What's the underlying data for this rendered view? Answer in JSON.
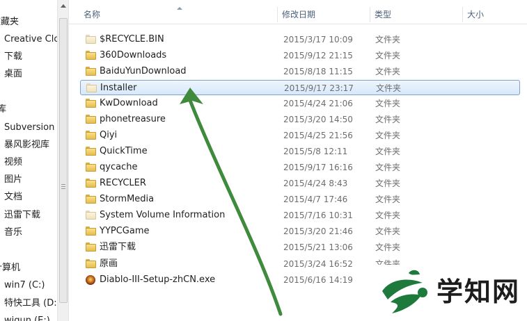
{
  "nav": {
    "items": [
      {
        "label": "收藏夹"
      },
      {
        "label": "Creative Cloud"
      },
      {
        "label": "下载"
      },
      {
        "label": "桌面"
      },
      {
        "label": "库"
      },
      {
        "label": "Subversion"
      },
      {
        "label": "暴风影视库"
      },
      {
        "label": "视频"
      },
      {
        "label": "图片"
      },
      {
        "label": "文档"
      },
      {
        "label": "迅雷下载"
      },
      {
        "label": "音乐"
      },
      {
        "label": "计算机"
      },
      {
        "label": "win7 (C:)"
      },
      {
        "label": "特快工具 (D:)"
      },
      {
        "label": "wiqun (E:)"
      }
    ]
  },
  "columns": {
    "name": "名称",
    "date": "修改日期",
    "type": "类型",
    "size": "大小"
  },
  "files": [
    {
      "name": "$RECYCLE.BIN",
      "date": "2015/3/17 10:09",
      "type": "文件夹",
      "icon": "folder-icon-pale"
    },
    {
      "name": "360Downloads",
      "date": "2015/9/12 21:15",
      "type": "文件夹",
      "icon": "folder-icon"
    },
    {
      "name": "BaiduYunDownload",
      "date": "2015/8/18 11:15",
      "type": "文件夹",
      "icon": "folder-icon"
    },
    {
      "name": "Installer",
      "date": "2015/9/17 23:17",
      "type": "文件夹",
      "icon": "folder-icon-pale",
      "selected": true
    },
    {
      "name": "KwDownload",
      "date": "2015/4/24 21:06",
      "type": "文件夹",
      "icon": "folder-icon"
    },
    {
      "name": "phonetreasure",
      "date": "2015/3/20 14:50",
      "type": "文件夹",
      "icon": "folder-icon"
    },
    {
      "name": "Qiyi",
      "date": "2015/4/25 21:56",
      "type": "文件夹",
      "icon": "folder-icon"
    },
    {
      "name": "QuickTime",
      "date": "2015/5/8 12:11",
      "type": "文件夹",
      "icon": "folder-icon"
    },
    {
      "name": "qycache",
      "date": "2015/9/17 16:16",
      "type": "文件夹",
      "icon": "folder-icon"
    },
    {
      "name": "RECYCLER",
      "date": "2015/4/24 8:43",
      "type": "文件夹",
      "icon": "folder-icon"
    },
    {
      "name": "StormMedia",
      "date": "2015/4/7 17:46",
      "type": "文件夹",
      "icon": "folder-icon"
    },
    {
      "name": "System Volume Information",
      "date": "2015/7/16 10:31",
      "type": "文件夹",
      "icon": "folder-icon-pale"
    },
    {
      "name": "YYPCGame",
      "date": "2015/3/20 21:46",
      "type": "文件夹",
      "icon": "folder-icon"
    },
    {
      "name": "迅雷下载",
      "date": "2015/5/21 13:06",
      "type": "文件夹",
      "icon": "folder-icon"
    },
    {
      "name": "原画",
      "date": "2015/3/24 16:52",
      "type": "文件夹",
      "icon": "folder-icon"
    },
    {
      "name": "Diablo-III-Setup-zhCN.exe",
      "date": "2015/6/16 14:19",
      "type": "",
      "icon": "diablo-exe-icon"
    }
  ],
  "annotation": {
    "color": "#3f8a3c",
    "icon": "green-arrow-icon"
  },
  "watermark": {
    "text": "学知网",
    "icon": "xuezhiwang-logo-icon",
    "color": "#1d7a3c"
  }
}
